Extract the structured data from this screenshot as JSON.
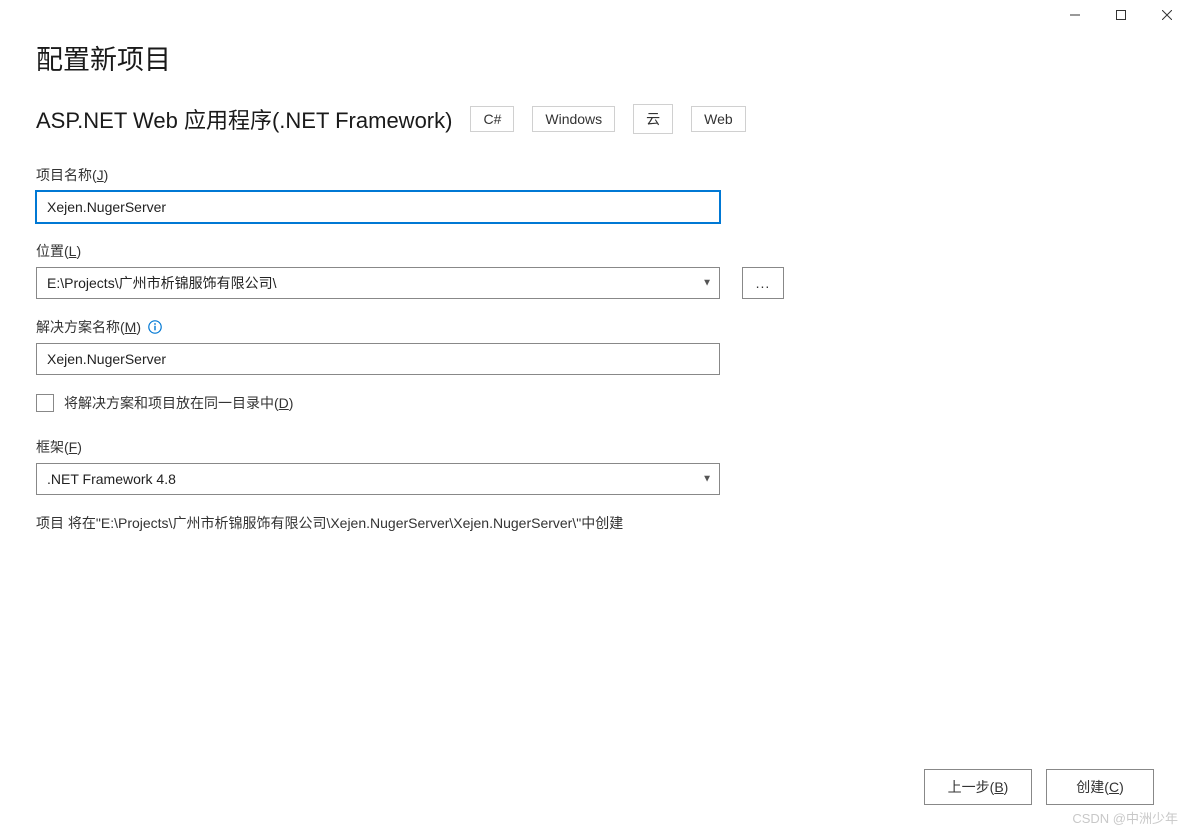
{
  "window": {
    "minimize_icon": "minimize",
    "maximize_icon": "maximize",
    "close_icon": "close"
  },
  "heading": "配置新项目",
  "subtitle": "ASP.NET Web 应用程序(.NET Framework)",
  "tags": {
    "t0": "C#",
    "t1": "Windows",
    "t2": "云",
    "t3": "Web"
  },
  "fields": {
    "project_name": {
      "label_prefix": "项目名称(",
      "label_key": "J",
      "label_suffix": ")",
      "value": "Xejen.NugerServer"
    },
    "location": {
      "label_prefix": "位置(",
      "label_key": "L",
      "label_suffix": ")",
      "value": "E:\\Projects\\广州市析锦服饰有限公司\\",
      "browse_label": "..."
    },
    "solution_name": {
      "label_prefix": "解决方案名称(",
      "label_key": "M",
      "label_suffix": ")",
      "value": "Xejen.NugerServer"
    },
    "same_dir_checkbox": {
      "label_prefix": "将解决方案和项目放在同一目录中(",
      "label_key": "D",
      "label_suffix": ")",
      "checked": false
    },
    "framework": {
      "label_prefix": "框架(",
      "label_key": "F",
      "label_suffix": ")",
      "value": ".NET Framework 4.8"
    }
  },
  "path_info": "项目 将在\"E:\\Projects\\广州市析锦服饰有限公司\\Xejen.NugerServer\\Xejen.NugerServer\\\"中创建",
  "footer": {
    "back": {
      "prefix": "上一步(",
      "key": "B",
      "suffix": ")"
    },
    "create": {
      "prefix": "创建(",
      "key": "C",
      "suffix": ")"
    }
  },
  "watermark": "CSDN @中洲少年"
}
